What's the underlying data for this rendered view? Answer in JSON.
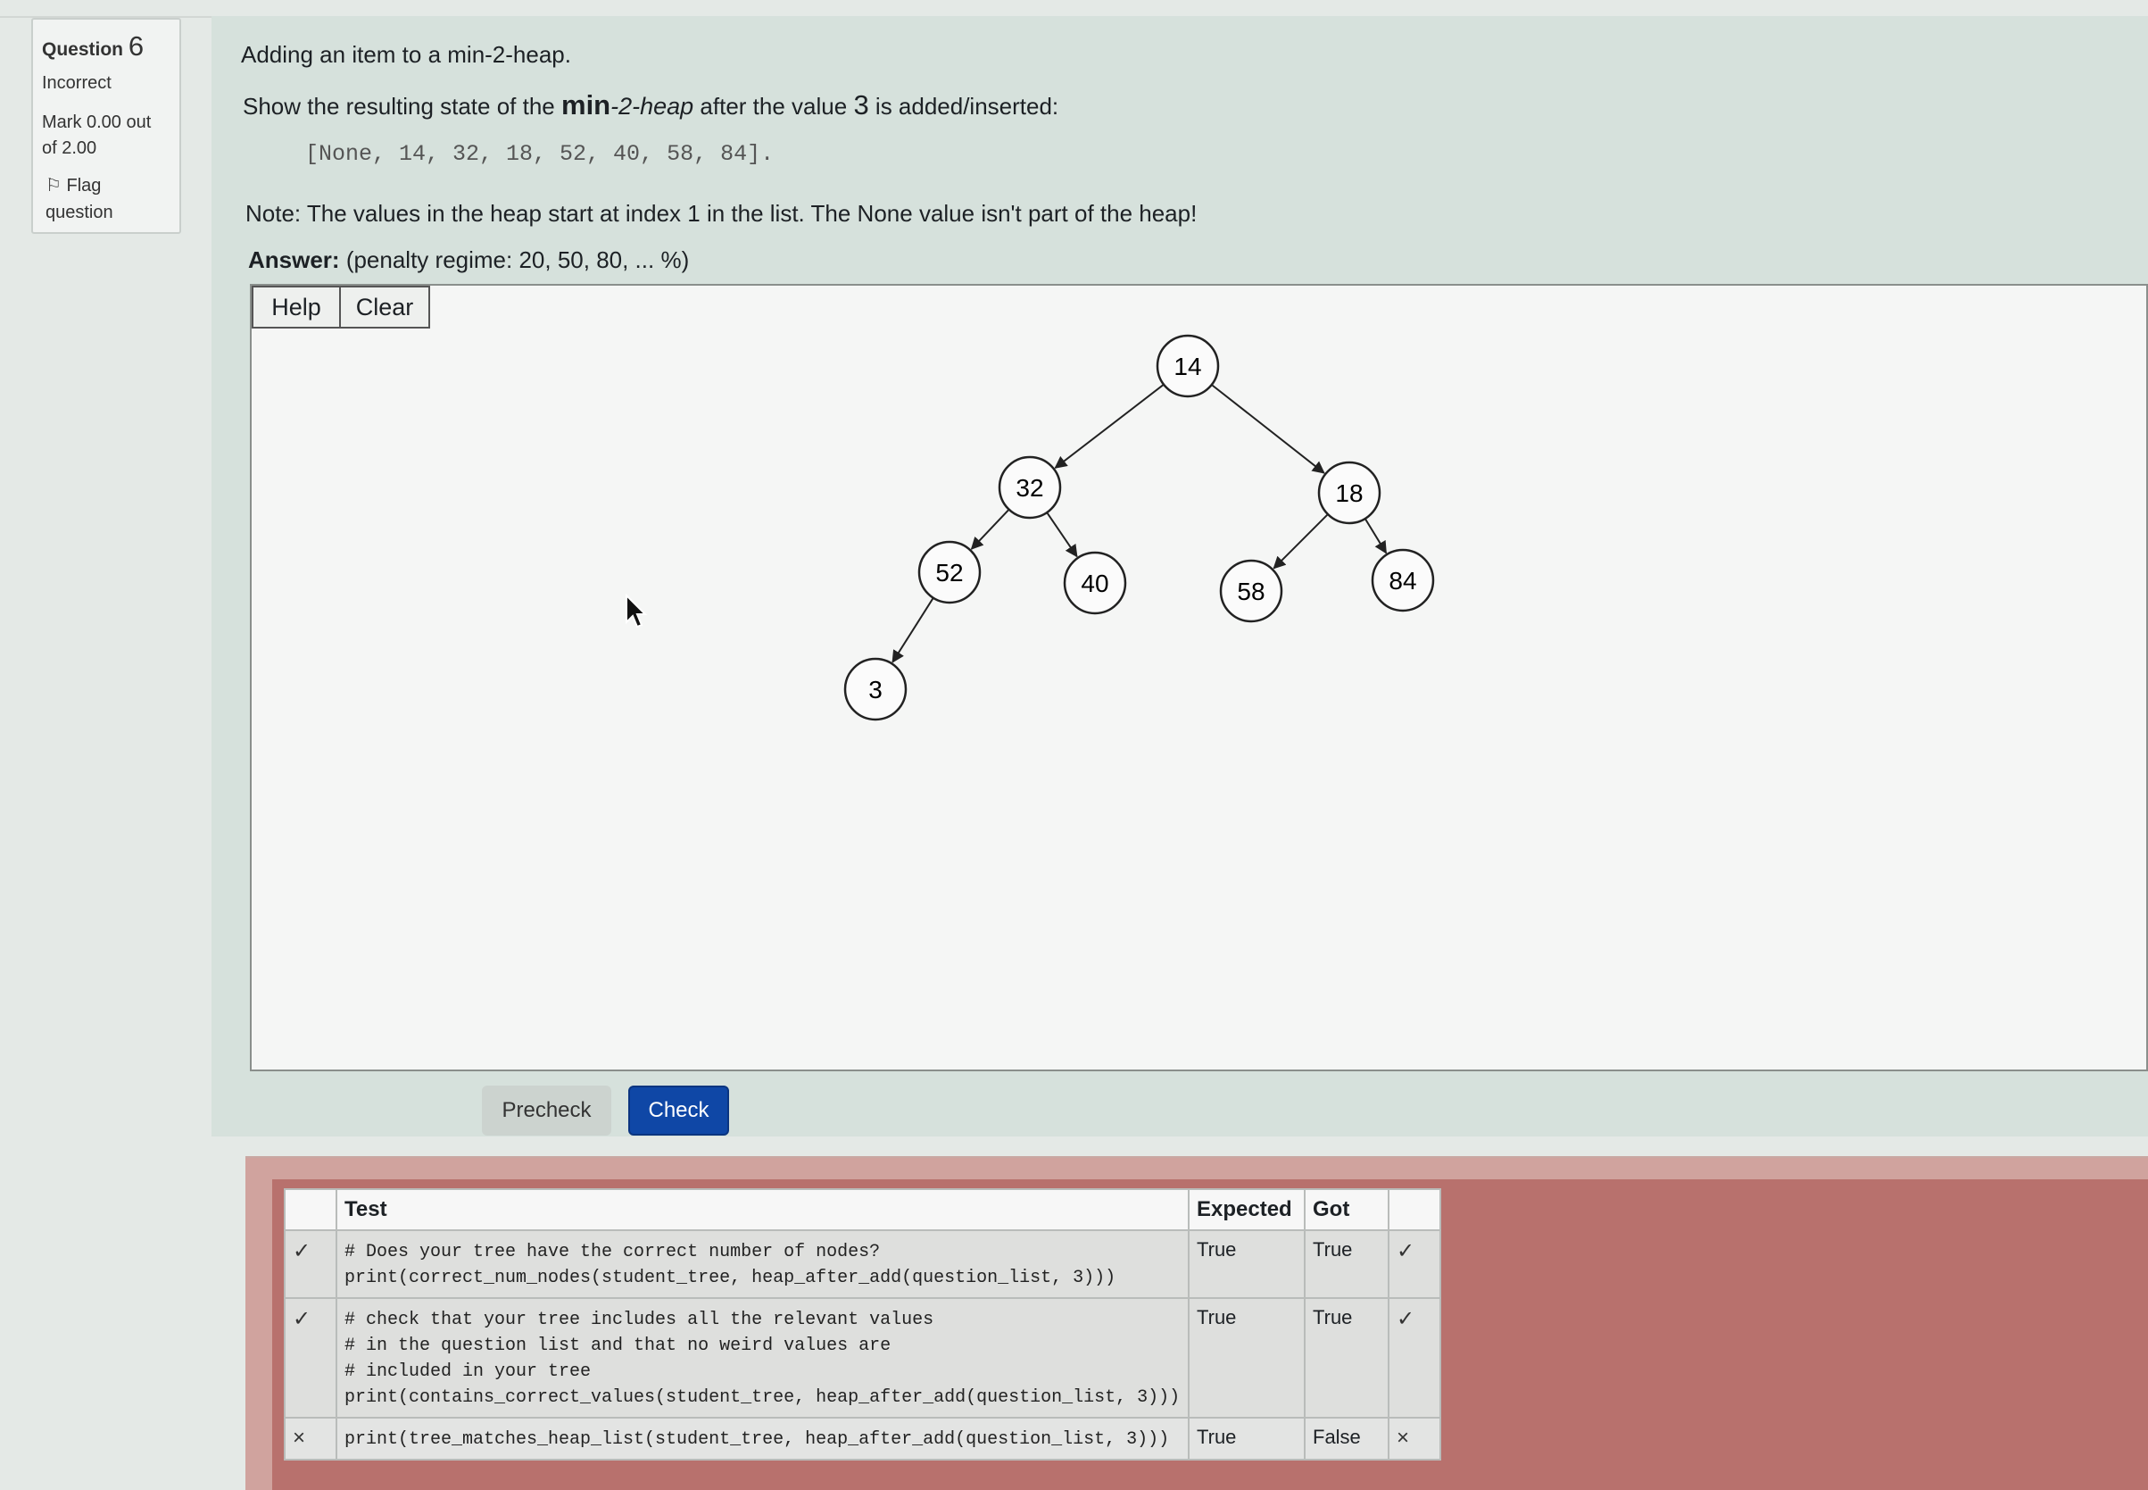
{
  "info": {
    "question_label": "Question",
    "question_number": "6",
    "state": "Incorrect",
    "mark_line1": "Mark 0.00 out",
    "mark_line2": "of 2.00",
    "flag_line1": "Flag",
    "flag_line2": "question"
  },
  "question": {
    "intro": "Adding an item to a min-2-heap.",
    "prompt_pre": "Show the resulting state of the ",
    "prompt_bold": "min",
    "prompt_italic": "-2-heap",
    "prompt_mid": " after the value ",
    "prompt_value": "3",
    "prompt_post": " is added/inserted:",
    "list": "[None, 14, 32, 18, 52, 40, 58, 84].",
    "note": "Note: The values in the heap start at index 1 in the list. The None value isn't part of the heap!",
    "answer_label": "Answer:",
    "penalty": "(penalty regime: 20, 50, 80, ... %)"
  },
  "toolbar": {
    "help": "Help",
    "clear": "Clear"
  },
  "tree": {
    "nodes": [
      {
        "id": "n14",
        "label": "14"
      },
      {
        "id": "n32",
        "label": "32"
      },
      {
        "id": "n18",
        "label": "18"
      },
      {
        "id": "n52",
        "label": "52"
      },
      {
        "id": "n40",
        "label": "40"
      },
      {
        "id": "n58",
        "label": "58"
      },
      {
        "id": "n84",
        "label": "84"
      },
      {
        "id": "n3",
        "label": "3"
      }
    ],
    "edges": [
      [
        "n14",
        "n32"
      ],
      [
        "n14",
        "n18"
      ],
      [
        "n32",
        "n52"
      ],
      [
        "n32",
        "n40"
      ],
      [
        "n18",
        "n58"
      ],
      [
        "n18",
        "n84"
      ],
      [
        "n52",
        "n3"
      ]
    ]
  },
  "buttons": {
    "precheck": "Precheck",
    "check": "Check"
  },
  "results": {
    "headers": {
      "test": "Test",
      "expected": "Expected",
      "got": "Got"
    },
    "rows": [
      {
        "status": "✓",
        "code": "# Does your tree have the correct number of nodes?\nprint(correct_num_nodes(student_tree, heap_after_add(question_list, 3)))",
        "expected": "True",
        "got": "True",
        "result": "✓"
      },
      {
        "status": "✓",
        "code": "# check that your tree includes all the relevant values\n# in the question list and that no weird values are\n# included in your tree\nprint(contains_correct_values(student_tree, heap_after_add(question_list, 3)))",
        "expected": "True",
        "got": "True",
        "result": "✓"
      },
      {
        "status": "×",
        "code": "print(tree_matches_heap_list(student_tree, heap_after_add(question_list, 3)))",
        "expected": "True",
        "got": "False",
        "result": "×"
      }
    ]
  }
}
